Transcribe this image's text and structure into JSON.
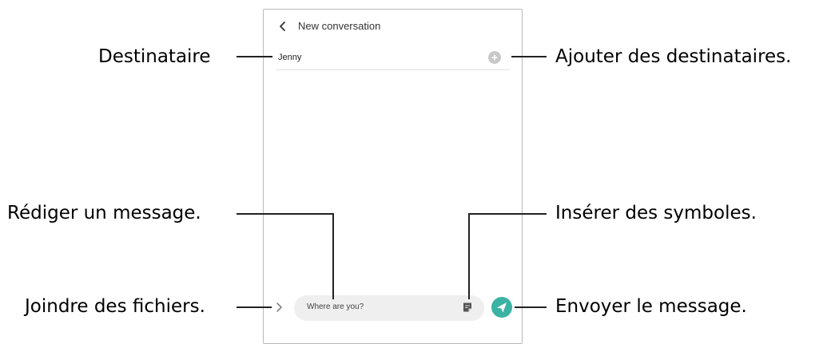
{
  "screen": {
    "title": "New conversation",
    "back_icon": "chevron-left-icon",
    "recipient": "Jenny",
    "add_recipient_icon": "add-contact-icon",
    "compose_text": "Where are you?",
    "attach_icon": "chevron-right-icon",
    "symbols_icon": "sticker-icon",
    "send_icon": "send-icon",
    "send_color": "#3bb3a4"
  },
  "callouts": {
    "recipient": "Destinataire",
    "add_recipients": "Ajouter des destinataires.",
    "compose": "Rédiger un message.",
    "symbols": "Insérer des symboles.",
    "attach": "Joindre des fichiers.",
    "send": "Envoyer le message."
  }
}
